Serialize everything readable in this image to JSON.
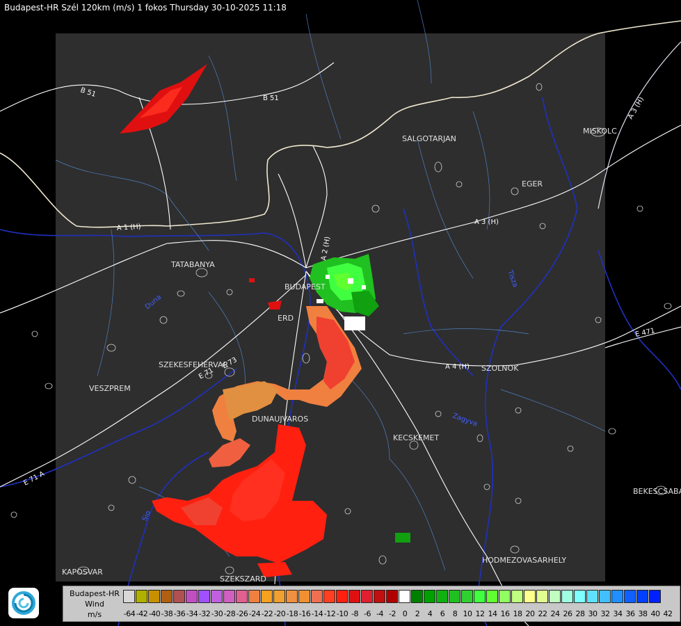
{
  "title": "Budapest-HR Szél 120km (m/s) 1 fokos Thursday 30-10-2025 11:18",
  "cities": [
    {
      "id": "salgotarjan",
      "label": "SALGOTARJAN"
    },
    {
      "id": "miskolc",
      "label": "MISKOLC"
    },
    {
      "id": "eger",
      "label": "EGER"
    },
    {
      "id": "tatabanya",
      "label": "TATABANYA"
    },
    {
      "id": "budapest",
      "label": "BUDAPEST"
    },
    {
      "id": "erd",
      "label": "ERD"
    },
    {
      "id": "szekesfehervar",
      "label": "SZEKESFEHERVAR"
    },
    {
      "id": "veszprem",
      "label": "VESZPREM"
    },
    {
      "id": "dunaujvaros",
      "label": "DUNAUJVAROS"
    },
    {
      "id": "kecskemet",
      "label": "KECSKEMET"
    },
    {
      "id": "szolnok",
      "label": "SZOLNOK"
    },
    {
      "id": "bekescsaba",
      "label": "BEKESCSABA"
    },
    {
      "id": "hodmezovasarhely",
      "label": "HODMEZOVASARHELY"
    },
    {
      "id": "kaposvar",
      "label": "KAPOSVAR"
    },
    {
      "id": "szekszard",
      "label": "SZEKSZARD"
    }
  ],
  "roads": [
    {
      "id": "b51-west",
      "label": "B 51"
    },
    {
      "id": "b51-east",
      "label": "B 51"
    },
    {
      "id": "a1",
      "label": "A 1 (H)"
    },
    {
      "id": "a2",
      "label": "A 2 (H)"
    },
    {
      "id": "a3",
      "label": "A 3 (H)"
    },
    {
      "id": "a3-ne",
      "label": "A 3 (H)"
    },
    {
      "id": "a4",
      "label": "A 4 (H)"
    },
    {
      "id": "e71",
      "label": "E 71"
    },
    {
      "id": "e73",
      "label": "E 73"
    },
    {
      "id": "e71-sw",
      "label": "E 71 A"
    },
    {
      "id": "e471",
      "label": "E 471"
    }
  ],
  "rivers": [
    {
      "id": "duna",
      "label": "Duna"
    },
    {
      "id": "tisza",
      "label": "Tisza"
    },
    {
      "id": "sio",
      "label": "Sio"
    },
    {
      "id": "zagyva",
      "label": "Zagyva"
    }
  ],
  "legend": {
    "line1": "Budapest-HR",
    "line2": "Wind",
    "line3": "m/s",
    "ticks": [
      "-64",
      "-42",
      "-40",
      "-38",
      "-36",
      "-34",
      "-32",
      "-30",
      "-28",
      "-26",
      "-24",
      "-22",
      "-20",
      "-18",
      "-16",
      "-14",
      "-12",
      "-10",
      "-8",
      "-6",
      "-4",
      "-2",
      "0",
      "2",
      "4",
      "6",
      "8",
      "10",
      "12",
      "14",
      "16",
      "18",
      "20",
      "22",
      "24",
      "26",
      "28",
      "30",
      "32",
      "34",
      "36",
      "38",
      "40",
      "42"
    ],
    "colors": [
      "#d8d8d8",
      "#b0b000",
      "#c89000",
      "#b06010",
      "#b05050",
      "#c050c0",
      "#a050ff",
      "#c060e0",
      "#d060c0",
      "#e06090",
      "#f08040",
      "#f8a020",
      "#f0a030",
      "#f09040",
      "#f09030",
      "#f07050",
      "#ff4020",
      "#ff2010",
      "#e01010",
      "#e02030",
      "#c01010",
      "#b00000",
      "#ffffff",
      "#008000",
      "#00a000",
      "#10b010",
      "#20c020",
      "#30d030",
      "#40ff40",
      "#60ff30",
      "#90ff60",
      "#c0ff80",
      "#ffff90",
      "#e0ff90",
      "#c0ffc0",
      "#a0ffe0",
      "#80ffff",
      "#60e0ff",
      "#40c0ff",
      "#2090ff",
      "#1060ff",
      "#0040ff",
      "#0020ff"
    ]
  },
  "logo": {
    "icon": "logo-icon"
  }
}
